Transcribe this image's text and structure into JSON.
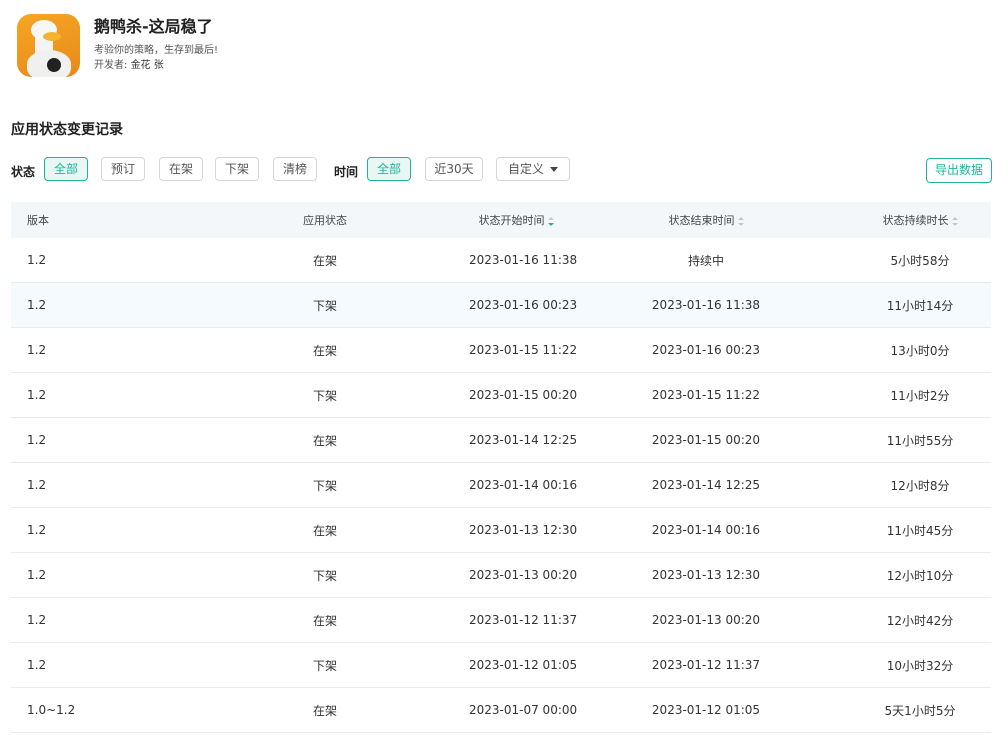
{
  "app": {
    "title": "鹅鸭杀-这局稳了",
    "subtitle": "考验你的策略，生存到最后!",
    "developer_label": "开发者: ",
    "developer_name": "金花 张"
  },
  "section_title": "应用状态变更记录",
  "filters": {
    "status_label": "状态",
    "status_options": [
      "全部",
      "预订",
      "在架",
      "下架",
      "清榜"
    ],
    "status_selected": "全部",
    "time_label": "时间",
    "time_options": [
      "全部",
      "近30天"
    ],
    "time_selected": "全部",
    "custom_label": "自定义",
    "export_label": "导出数据"
  },
  "table": {
    "headers": [
      "版本",
      "应用状态",
      "状态开始时间",
      "状态结束时间",
      "状态持续时长"
    ],
    "rows": [
      [
        "1.2",
        "在架",
        "2023-01-16 11:38",
        "持续中",
        "5小时58分"
      ],
      [
        "1.2",
        "下架",
        "2023-01-16 00:23",
        "2023-01-16 11:38",
        "11小时14分"
      ],
      [
        "1.2",
        "在架",
        "2023-01-15 11:22",
        "2023-01-16 00:23",
        "13小时0分"
      ],
      [
        "1.2",
        "下架",
        "2023-01-15 00:20",
        "2023-01-15 11:22",
        "11小时2分"
      ],
      [
        "1.2",
        "在架",
        "2023-01-14 12:25",
        "2023-01-15 00:20",
        "11小时55分"
      ],
      [
        "1.2",
        "下架",
        "2023-01-14 00:16",
        "2023-01-14 12:25",
        "12小时8分"
      ],
      [
        "1.2",
        "在架",
        "2023-01-13 12:30",
        "2023-01-14 00:16",
        "11小时45分"
      ],
      [
        "1.2",
        "下架",
        "2023-01-13 00:20",
        "2023-01-13 12:30",
        "12小时10分"
      ],
      [
        "1.2",
        "在架",
        "2023-01-12 11:37",
        "2023-01-13 00:20",
        "12小时42分"
      ],
      [
        "1.2",
        "下架",
        "2023-01-12 01:05",
        "2023-01-12 11:37",
        "10小时32分"
      ],
      [
        "1.0~1.2",
        "在架",
        "2023-01-07 00:00",
        "2023-01-12 01:05",
        "5天1小时5分"
      ]
    ]
  },
  "colors": {
    "accent": "#1fb59a",
    "header_bg": "#f3f7f9",
    "hover_row_bg": "#f4fafe"
  }
}
